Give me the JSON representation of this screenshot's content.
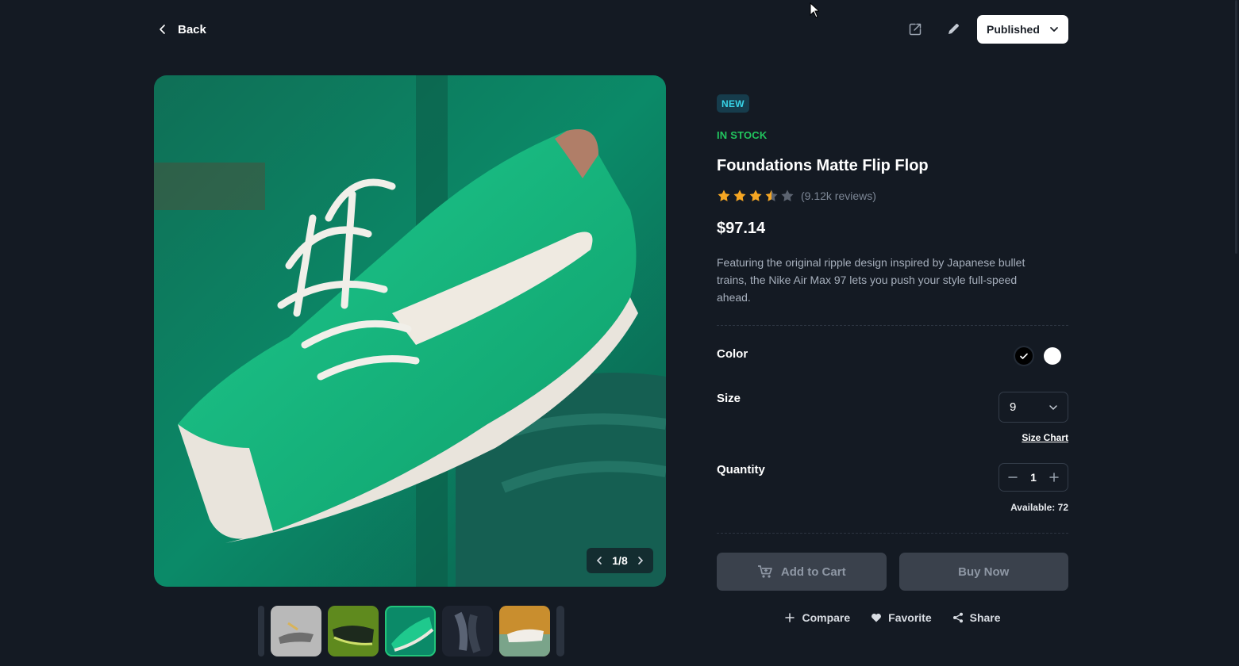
{
  "header": {
    "back_label": "Back",
    "status_label": "Published",
    "icons": [
      "external-link-icon",
      "pencil-icon",
      "chevron-down-icon"
    ]
  },
  "gallery": {
    "page_indicator": "1/8",
    "current_index": 1,
    "total": 8
  },
  "product": {
    "badge": "NEW",
    "stock": "IN STOCK",
    "title": "Foundations Matte Flip Flop",
    "rating": 3.5,
    "max_rating": 5,
    "reviews": "(9.12k reviews)",
    "price": "$97.14",
    "description": "Featuring the original ripple design inspired by Japanese bullet trains, the Nike Air Max 97 lets you push your style full-speed ahead."
  },
  "options": {
    "color_label": "Color",
    "colors": [
      {
        "name": "black",
        "hex": "#000000",
        "selected": true
      },
      {
        "name": "white",
        "hex": "#ffffff",
        "selected": false
      }
    ],
    "size_label": "Size",
    "size_value": "9",
    "size_chart_label": "Size Chart",
    "quantity_label": "Quantity",
    "quantity_value": "1",
    "available_text": "Available: 72"
  },
  "actions": {
    "add_to_cart": "Add to Cart",
    "buy_now": "Buy Now",
    "compare": "Compare",
    "favorite": "Favorite",
    "share": "Share"
  },
  "colors": {
    "background": "#141a23",
    "accent_green": "#22c55e",
    "badge_bg": "#163c4c",
    "badge_text": "#38d3e7",
    "star": "#f5a623",
    "button_disabled": "#3a414c"
  }
}
